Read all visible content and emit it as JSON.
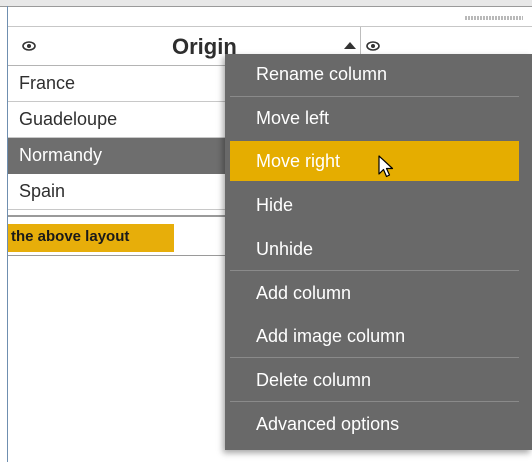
{
  "table": {
    "header": {
      "title": "Origin"
    },
    "rows": [
      {
        "value": "France"
      },
      {
        "value": "Guadeloupe"
      },
      {
        "value": "Normandy",
        "selected": true
      },
      {
        "value": "Spain"
      }
    ]
  },
  "callout": {
    "text": "the above layout",
    "color": "#e7ae0a"
  },
  "context_menu": {
    "items": [
      {
        "label": "Rename column"
      },
      {
        "label": "Move left"
      },
      {
        "label": "Move right",
        "highlighted": true
      },
      {
        "label": "Hide"
      },
      {
        "label": "Unhide"
      },
      {
        "label": "Add column"
      },
      {
        "label": "Add image column"
      },
      {
        "label": "Delete column"
      },
      {
        "label": "Advanced options"
      }
    ],
    "highlight_color": "#e5ad00",
    "background_color": "#696969"
  },
  "icons": [
    "eye-icon",
    "sort-ascending-icon",
    "mouse-pointer-icon",
    "resize-grip-icon"
  ]
}
